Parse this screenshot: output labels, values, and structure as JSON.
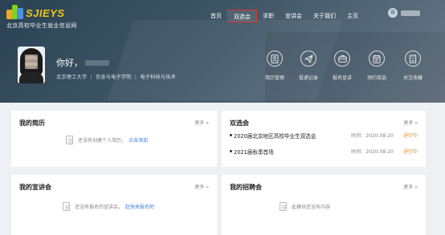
{
  "header": {
    "logo_text": "SJIEYS",
    "logo_subtitle": "北京高校毕业生就业信息网",
    "nav": [
      {
        "label": "首页"
      },
      {
        "label": "双选会",
        "active": true
      },
      {
        "label": "求职"
      },
      {
        "label": "宣讲会"
      },
      {
        "label": "关于我们"
      },
      {
        "label": "主页"
      }
    ]
  },
  "profile": {
    "greeting": "你好，",
    "school": "北京理工大学",
    "college": "信息与电子学院",
    "major": "电子科技与技术"
  },
  "quick_links": [
    {
      "label": "简历管理",
      "icon": "resume-icon"
    },
    {
      "label": "投递记录",
      "icon": "send-icon"
    },
    {
      "label": "报名宣讲",
      "icon": "briefcase-icon"
    },
    {
      "label": "预约双选",
      "icon": "calendar-icon"
    },
    {
      "label": "关注收藏",
      "icon": "building-icon"
    }
  ],
  "cards": {
    "resume": {
      "title": "我的简历",
      "more": "更多 »",
      "empty_text": "还没有创建个人简历，",
      "empty_link": "点击添加"
    },
    "fairs": {
      "title": "双选会",
      "more": "更多 »",
      "items": [
        {
          "title": "2020届北京地区高校毕业生双选会",
          "time": "时间：2020-08-20",
          "status": "进行中"
        },
        {
          "title": "2021届秋季首场",
          "time": "时间：2020-08-20",
          "status": "进行中"
        }
      ]
    },
    "talks": {
      "title": "我的宣讲会",
      "more": "更多 »",
      "empty_text": "还没有报名的宣讲会，",
      "empty_link": "赶快来报名吧"
    },
    "recruit": {
      "title": "我的招聘会",
      "more": "更多 »",
      "empty_text": "此模块还没有内容"
    }
  },
  "colors": {
    "accent_red": "#e0302a",
    "link_blue": "#3b7ddd",
    "status_orange": "#e08e2b"
  }
}
